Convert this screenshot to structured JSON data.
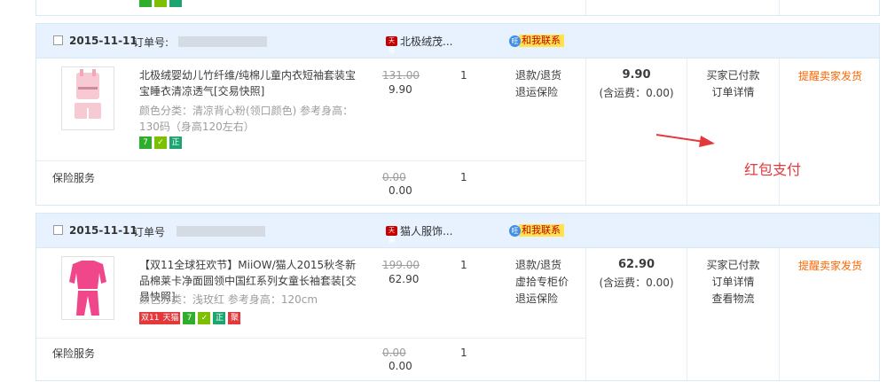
{
  "orders": [
    {
      "date": "2015-11-11",
      "order_no_label": "订单号:",
      "shop_name": "北极绒茂...",
      "contact": "和我联系",
      "product": {
        "title": "北极绒婴幼儿竹纤维/纯棉儿童内衣短袖套装宝宝睡衣清凉透气[交易快照]",
        "spec": "颜色分类：清凉背心粉(领口颜色)   参考身高：130码（身高120左右）",
        "badges": [
          "7",
          "正"
        ],
        "price_original": "131.00",
        "price": "9.90",
        "quantity": "1",
        "services": [
          "退款/退货",
          "退运保险"
        ]
      },
      "insurance": {
        "label": "保险服务",
        "price_original": "0.00",
        "price": "0.00",
        "quantity": "1"
      },
      "total": "9.90",
      "shipping": "(含运费：0.00)",
      "status": [
        "买家已付款",
        "订单详情"
      ],
      "action": "提醒卖家发货"
    },
    {
      "date": "2015-11-11",
      "order_no_label": "订单号",
      "shop_name": "猫人服饰...",
      "contact": "和我联系",
      "product": {
        "title": "【双11全球狂欢节】MiiOW/猫人2015秋冬新品棉莱卡净面圆领中国红系列女童长袖套装[交易快照]",
        "spec": "颜色分类：浅玫红   参考身高：120cm",
        "tag_double11": "双11",
        "tag_tmall": "天猫",
        "badges": [
          "7",
          "正",
          "聚"
        ],
        "price_original": "199.00",
        "price": "62.90",
        "quantity": "1",
        "services": [
          "退款/退货",
          "虚拾专柜价",
          "退运保险"
        ]
      },
      "insurance": {
        "label": "保险服务",
        "price_original": "0.00",
        "price": "0.00",
        "quantity": "1"
      },
      "total": "62.90",
      "shipping": "(含运费：0.00)",
      "status": [
        "买家已付款",
        "订单详情",
        "查看物流"
      ],
      "action": "提醒卖家发货"
    }
  ],
  "annotation": {
    "text": "红包支付",
    "color": "#e4393c"
  },
  "colors": {
    "accent": "#ff6600",
    "header_bg": "#e8f2ff",
    "border": "#d6eaf5"
  }
}
